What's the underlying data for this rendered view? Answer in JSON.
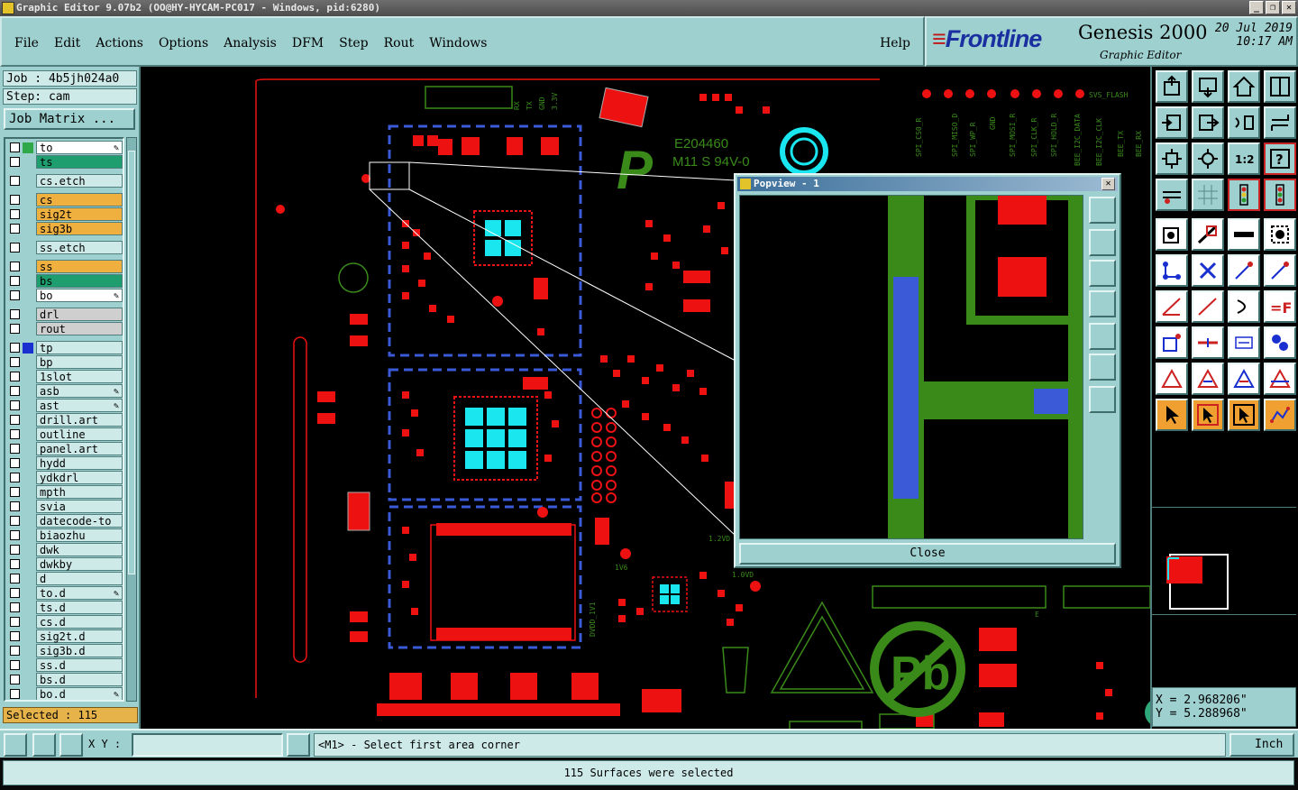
{
  "window": {
    "title": "Graphic Editor 9.07b2 (OO@HY-HYCAM-PC017 - Windows, pid:6280)"
  },
  "menu": {
    "items": [
      "File",
      "Edit",
      "Actions",
      "Options",
      "Analysis",
      "DFM",
      "Step",
      "Rout",
      "Windows"
    ],
    "help": "Help"
  },
  "brand": {
    "logo_text": "Frontline",
    "product": "Genesis 2000",
    "subtitle": "Graphic Editor",
    "date": "20 Jul 2019",
    "time": "10:17 AM"
  },
  "job": {
    "job_label": "Job : 4b5jh024a0",
    "step_label": "Step: cam",
    "job_matrix_button": "Job Matrix ..."
  },
  "layers": [
    {
      "name": "to",
      "color": "#ffffff",
      "box": "#2fa84a",
      "edit": true,
      "gap": false
    },
    {
      "name": "ts",
      "color": "#1e9e6e",
      "box": "",
      "edit": false,
      "gap": false
    },
    {
      "name": "cs.etch",
      "color": "#cde9e8",
      "box": "",
      "edit": false,
      "gap": true
    },
    {
      "name": "cs",
      "color": "#f0b040",
      "box": "",
      "edit": false,
      "gap": true
    },
    {
      "name": "sig2t",
      "color": "#f0b040",
      "box": "",
      "edit": false,
      "gap": false
    },
    {
      "name": "sig3b",
      "color": "#f0b040",
      "box": "",
      "edit": false,
      "gap": false
    },
    {
      "name": "ss.etch",
      "color": "#cde9e8",
      "box": "",
      "edit": false,
      "gap": true
    },
    {
      "name": "ss",
      "color": "#f0b040",
      "box": "",
      "edit": false,
      "gap": true
    },
    {
      "name": "bs",
      "color": "#1e9e6e",
      "box": "",
      "edit": false,
      "gap": false
    },
    {
      "name": "bo",
      "color": "#ffffff",
      "box": "",
      "edit": true,
      "gap": false
    },
    {
      "name": "drl",
      "color": "#cfcfcf",
      "box": "",
      "edit": false,
      "gap": true
    },
    {
      "name": "rout",
      "color": "#cfcfcf",
      "box": "",
      "edit": false,
      "gap": false
    },
    {
      "name": "tp",
      "color": "#cde9e8",
      "box": "#1a2fd0",
      "edit": false,
      "gap": true
    },
    {
      "name": "bp",
      "color": "#cde9e8",
      "box": "",
      "edit": false,
      "gap": false
    },
    {
      "name": "1slot",
      "color": "#cde9e8",
      "box": "",
      "edit": false,
      "gap": false
    },
    {
      "name": "asb",
      "color": "#cde9e8",
      "box": "",
      "edit": true,
      "gap": false
    },
    {
      "name": "ast",
      "color": "#cde9e8",
      "box": "",
      "edit": true,
      "gap": false
    },
    {
      "name": "drill.art",
      "color": "#cde9e8",
      "box": "",
      "edit": false,
      "gap": false
    },
    {
      "name": "outline",
      "color": "#cde9e8",
      "box": "",
      "edit": false,
      "gap": false
    },
    {
      "name": "panel.art",
      "color": "#cde9e8",
      "box": "",
      "edit": false,
      "gap": false
    },
    {
      "name": "hydd",
      "color": "#cde9e8",
      "box": "",
      "edit": false,
      "gap": false
    },
    {
      "name": "ydkdrl",
      "color": "#cde9e8",
      "box": "",
      "edit": false,
      "gap": false
    },
    {
      "name": "mpth",
      "color": "#cde9e8",
      "box": "",
      "edit": false,
      "gap": false
    },
    {
      "name": "svia",
      "color": "#cde9e8",
      "box": "",
      "edit": false,
      "gap": false
    },
    {
      "name": "datecode-to",
      "color": "#cde9e8",
      "box": "",
      "edit": false,
      "gap": false
    },
    {
      "name": "biaozhu",
      "color": "#cde9e8",
      "box": "",
      "edit": false,
      "gap": false
    },
    {
      "name": "dwk",
      "color": "#cde9e8",
      "box": "",
      "edit": false,
      "gap": false
    },
    {
      "name": "dwkby",
      "color": "#cde9e8",
      "box": "",
      "edit": false,
      "gap": false
    },
    {
      "name": "d",
      "color": "#cde9e8",
      "box": "",
      "edit": false,
      "gap": false
    },
    {
      "name": "to.d",
      "color": "#cde9e8",
      "box": "",
      "edit": true,
      "gap": false
    },
    {
      "name": "ts.d",
      "color": "#cde9e8",
      "box": "",
      "edit": false,
      "gap": false
    },
    {
      "name": "cs.d",
      "color": "#cde9e8",
      "box": "",
      "edit": false,
      "gap": false
    },
    {
      "name": "sig2t.d",
      "color": "#cde9e8",
      "box": "",
      "edit": false,
      "gap": false
    },
    {
      "name": "sig3b.d",
      "color": "#cde9e8",
      "box": "",
      "edit": false,
      "gap": false
    },
    {
      "name": "ss.d",
      "color": "#cde9e8",
      "box": "",
      "edit": false,
      "gap": false
    },
    {
      "name": "bs.d",
      "color": "#cde9e8",
      "box": "",
      "edit": false,
      "gap": false
    },
    {
      "name": "bo.d",
      "color": "#cde9e8",
      "box": "",
      "edit": true,
      "gap": false
    }
  ],
  "selection": {
    "label": "Selected : 115"
  },
  "pcb_text": {
    "cert": "E204460",
    "material": "M11 S 94V-0",
    "svs_flash": "SVS_FLASH",
    "pin_labels": [
      "SPI_CS0_R",
      "SPI_MISO_D",
      "SPI_WP_R",
      "GND",
      "SPI_MOSI_R",
      "SPI_CLK_R",
      "SPI_HOLD_R",
      "BEE_I2C_DATA",
      "BEE_I2C_CLK",
      "BEE_TX",
      "BEE_RX"
    ],
    "top_labels": [
      "RX",
      "TX",
      "GND",
      "3.3V"
    ],
    "small_labels": [
      "1.2VD",
      "1.0VD",
      "1V6",
      "DVDD_1V1",
      "E"
    ]
  },
  "popview": {
    "title": "Popview - 1",
    "close_label": "Close"
  },
  "coords": {
    "x": "X = 2.968206\"",
    "y": "Y = 5.288968\""
  },
  "bottom": {
    "xy_label": "X Y :",
    "xy_value": "",
    "prompt": "<M1> - Select first area corner",
    "unit": "Inch"
  },
  "status": {
    "message": "115 Surfaces were selected"
  },
  "colors": {
    "panel": "#9ed0cf",
    "pcb_red": "#ee1111",
    "pcb_green": "#3a8a1a",
    "pcb_cyan": "#19e6ee",
    "pcb_blue": "#3a5ad8"
  },
  "right_tools": [
    "open-icon",
    "save-icon",
    "home-icon",
    "window-icon",
    "prev-icon",
    "next-icon",
    "flip-icon",
    "rotate-icon",
    "fit-icon",
    "zoom-fit-icon",
    "ratio-icon",
    "help-icon",
    "measure-icon",
    "grid-icon",
    "traffic-icon",
    "traffic2-icon"
  ]
}
